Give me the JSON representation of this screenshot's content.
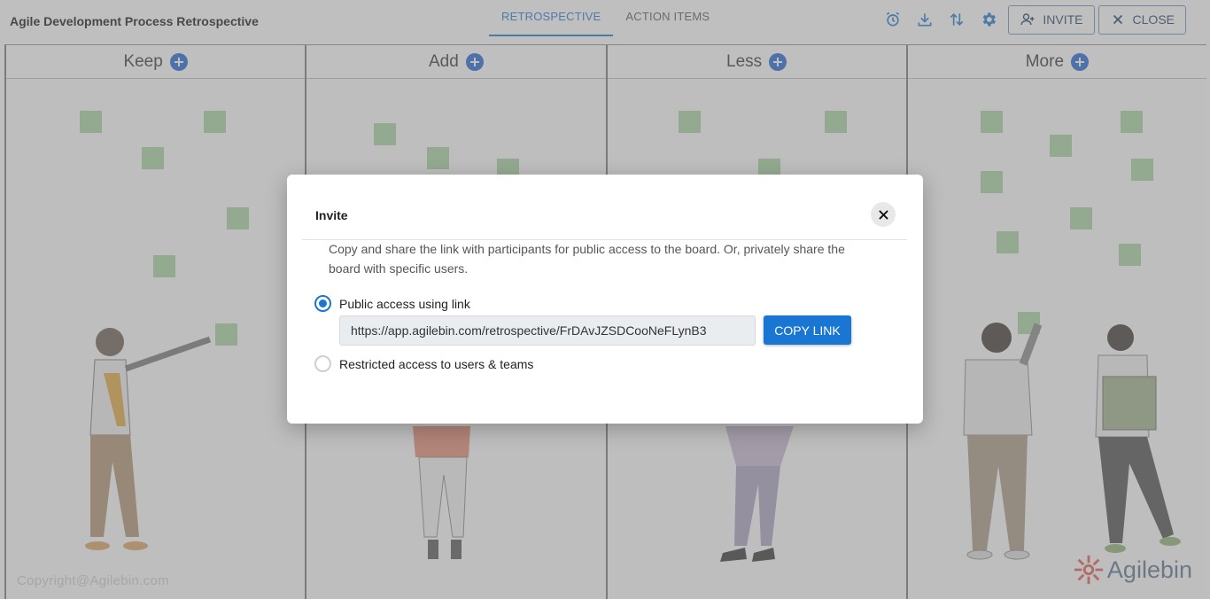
{
  "header": {
    "title": "Agile Development Process Retrospective",
    "tabs": [
      {
        "label": "RETROSPECTIVE",
        "active": true
      },
      {
        "label": "ACTION ITEMS",
        "active": false
      }
    ],
    "toolbar": {
      "icons": [
        "alarm-clock-icon",
        "download-icon",
        "sort-arrows-icon",
        "gear-icon"
      ],
      "invite_label": "INVITE",
      "close_label": "CLOSE"
    }
  },
  "board": {
    "columns": [
      {
        "title": "Keep"
      },
      {
        "title": "Add"
      },
      {
        "title": "Less"
      },
      {
        "title": "More"
      }
    ],
    "copyright": "Copyright@Agilebin.com",
    "brand": "Agilebin"
  },
  "dialog": {
    "title": "Invite",
    "description": "Copy and share the link with participants for public access to the board. Or, privately share the board with specific users.",
    "options": [
      {
        "label": "Public access using link",
        "checked": true
      },
      {
        "label": "Restricted access to users & teams",
        "checked": false
      }
    ],
    "link_value": "https://app.agilebin.com/retrospective/FrDAvJZSDCooNeFLynB3",
    "copy_label": "COPY LINK"
  },
  "colors": {
    "accent": "#1976d2",
    "add_button": "#1e63d5",
    "sticky_note": "#a8d5a0",
    "overlay": "rgba(128,128,128,0.5)"
  }
}
